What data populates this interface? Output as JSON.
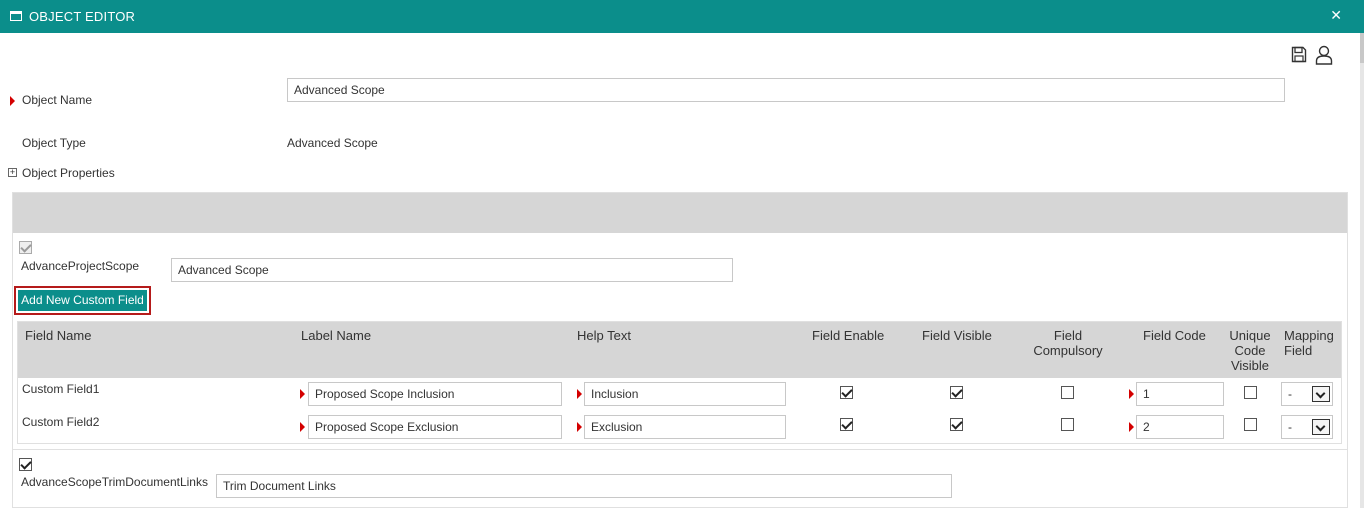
{
  "window": {
    "title": "OBJECT EDITOR",
    "close_glyph": "✕"
  },
  "toolbar": {
    "save_icon": "save-icon",
    "user_icon": "user-icon"
  },
  "form": {
    "object_name_label": "Object Name",
    "object_name_value": "Advanced Scope",
    "object_type_label": "Object Type",
    "object_type_value": "Advanced Scope",
    "object_properties_label": "Object Properties",
    "object_properties_toggle": "+"
  },
  "section1": {
    "checked": true,
    "label": "AdvanceProjectScope",
    "value": "Advanced Scope",
    "add_button": "Add New Custom Field"
  },
  "grid": {
    "headers": {
      "field_name": "Field Name",
      "label_name": "Label Name",
      "help_text": "Help Text",
      "field_enable": "Field Enable",
      "field_visible": "Field Visible",
      "field_compulsory_1": "Field",
      "field_compulsory_2": "Compulsory",
      "field_code": "Field Code",
      "unique_1": "Unique",
      "unique_2": "Code",
      "unique_3": "Visible",
      "mapping_1": "Mapping",
      "mapping_2": "Field"
    },
    "rows": [
      {
        "field_name": "Custom Field1",
        "label_name": "Proposed Scope Inclusion",
        "help_text": "Inclusion",
        "enable": true,
        "visible": true,
        "compulsory": false,
        "code": "1",
        "unique": false,
        "mapping": "-"
      },
      {
        "field_name": "Custom Field2",
        "label_name": "Proposed Scope Exclusion",
        "help_text": "Exclusion",
        "enable": true,
        "visible": true,
        "compulsory": false,
        "code": "2",
        "unique": false,
        "mapping": "-"
      }
    ]
  },
  "section2": {
    "checked": true,
    "label": "AdvanceScopeTrimDocumentLinks",
    "value": "Trim Document Links"
  },
  "colors": {
    "accent": "#0b8e8b",
    "required_marker": "#d40000",
    "highlight_border": "#b51a1a",
    "header_bg": "#d6d6d6"
  }
}
